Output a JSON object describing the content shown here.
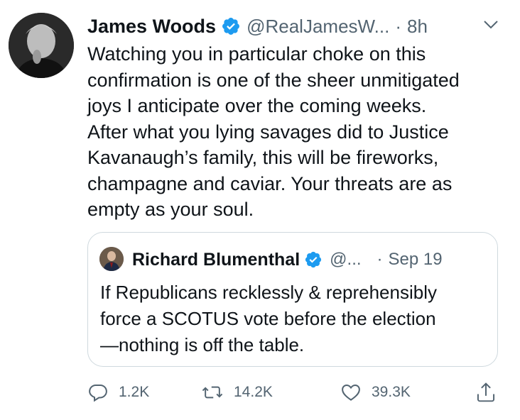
{
  "tweet": {
    "author_name": "James Woods",
    "author_handle": "@RealJamesW...",
    "separator": "·",
    "time": "8h",
    "text": "Watching you in particular choke on this\nconfirmation is one of the sheer unmitigated\njoys I anticipate over the coming weeks.\nAfter what you lying savages did to Justice\nKavanaugh’s family, this will be fireworks,\nchampagne and caviar. Your threats are as\nempty as your soul.",
    "quoted": {
      "author_name": "Richard Blumenthal",
      "author_handle": "@...",
      "separator": "·",
      "time": "Sep 19",
      "text": "If Republicans recklessly & reprehensibly\nforce a SCOTUS vote before the election\n—nothing is off the table."
    },
    "actions": {
      "replies": "1.2K",
      "retweets": "14.2K",
      "likes": "39.3K"
    }
  },
  "icons": {
    "verified": "verified-badge-icon",
    "caret": "chevron-down-icon",
    "reply": "reply-icon",
    "retweet": "retweet-icon",
    "like": "heart-icon",
    "share": "share-icon"
  },
  "colors": {
    "verified_blue": "#1d9bf0",
    "secondary_text": "#536471",
    "border": "#cfd9de"
  }
}
